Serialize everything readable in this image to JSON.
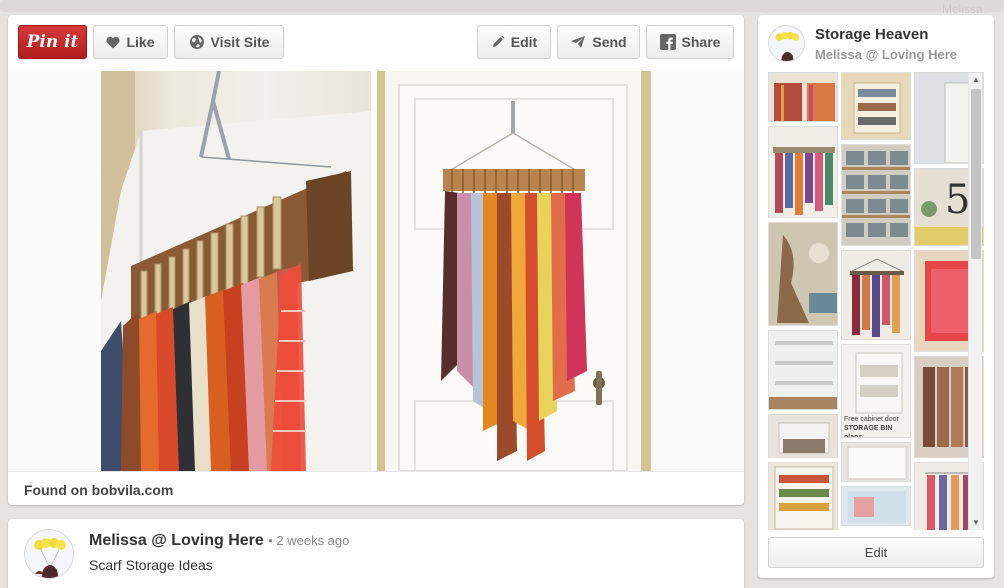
{
  "toolbar": {
    "pin_it_label": "Pin it",
    "like_label": "Like",
    "visit_site_label": "Visit Site",
    "edit_label": "Edit",
    "send_label": "Send",
    "share_label": "Share"
  },
  "pin": {
    "found_on": "Found on bobvila.com"
  },
  "comment": {
    "author": "Melissa @ Loving Here",
    "time": "• 2 weeks ago",
    "text": "Scarf Storage Ideas"
  },
  "board": {
    "title": "Storage Heaven",
    "owner": "Melissa @ Loving Here",
    "edit_label": "Edit",
    "thumb_caption_line1": "Free cabinet door",
    "thumb_caption_line2": "STORAGE BIN plans"
  },
  "background_faint_text": "Melissa",
  "colors": {
    "pin_it_red": "#c8232c",
    "background": "#e6e3e3"
  },
  "icons": {
    "like": "heart-icon",
    "visit": "globe-icon",
    "edit": "pencil-icon",
    "send": "paper-plane-icon",
    "share": "facebook-icon"
  }
}
